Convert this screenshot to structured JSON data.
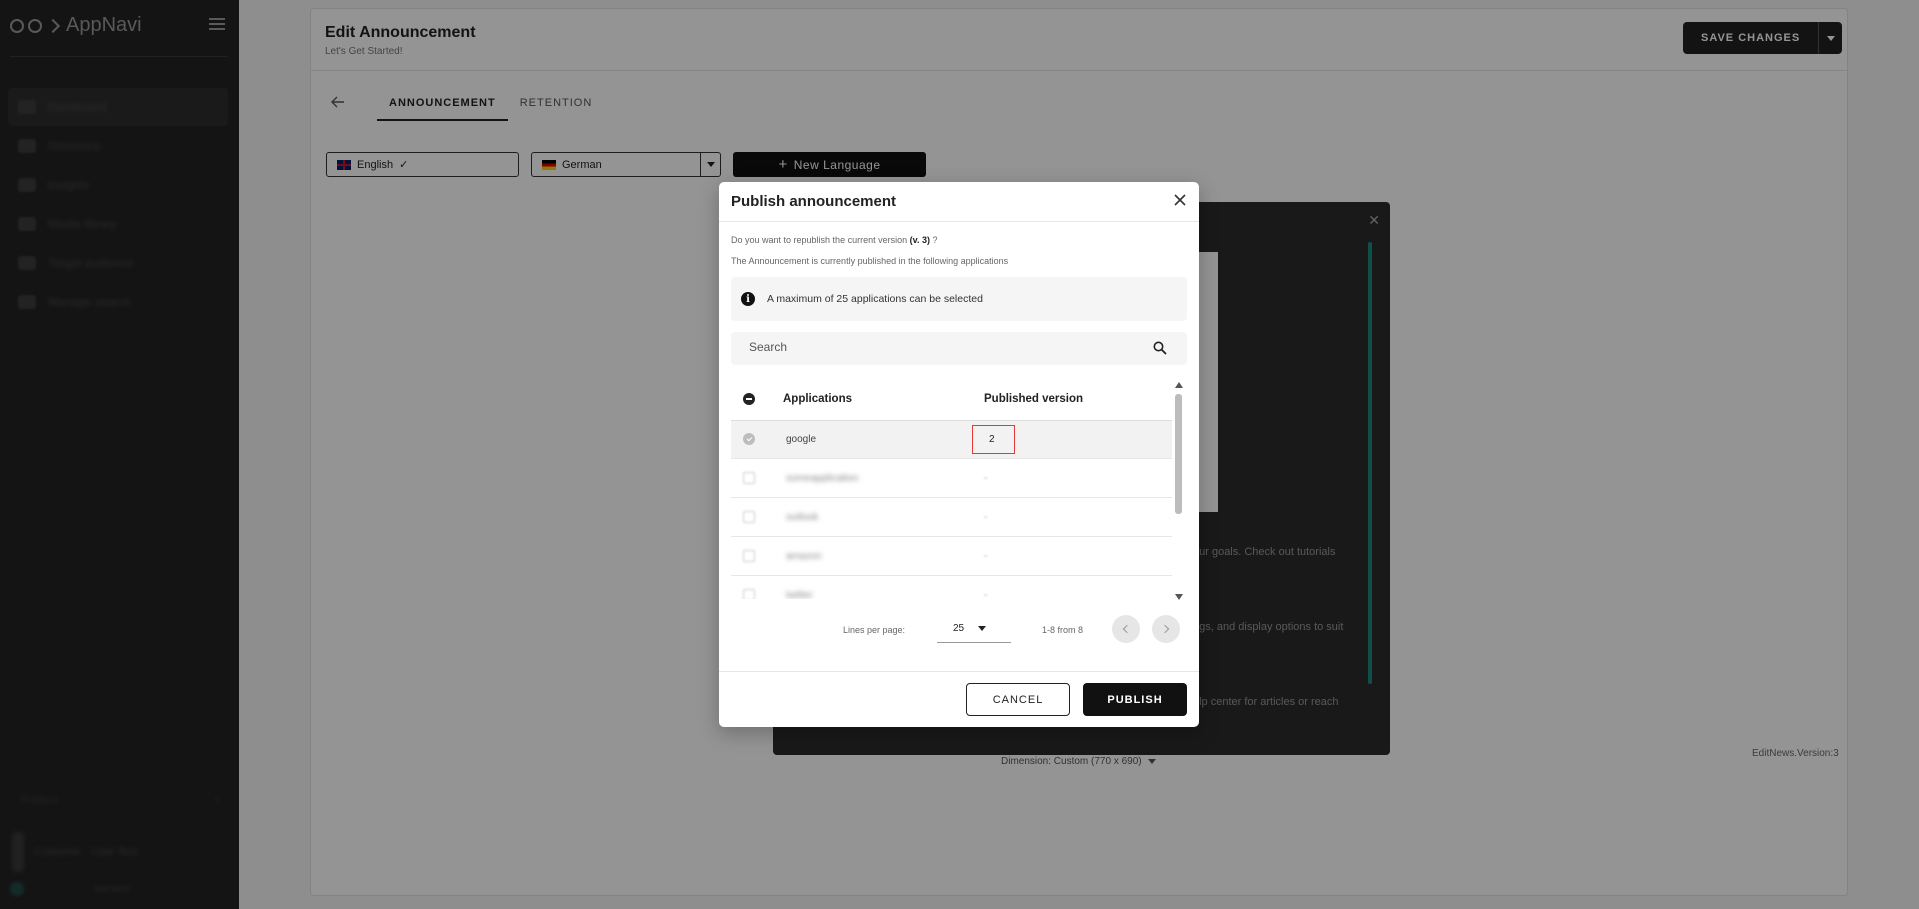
{
  "app": {
    "name": "AppNavi"
  },
  "sidebar": {
    "items": [
      {
        "label": "Dashboard",
        "icon": "dashboard-icon"
      },
      {
        "label": "Discovery",
        "icon": "discovery-icon"
      },
      {
        "label": "Insights",
        "icon": "insights-icon"
      },
      {
        "label": "Media library",
        "icon": "media-icon"
      },
      {
        "label": "Target audience",
        "icon": "audience-icon"
      },
      {
        "label": "Manage search",
        "icon": "search-manage-icon"
      }
    ],
    "bottom_label": "Product",
    "user_label": "Customer · User Test",
    "footer_label": "Version"
  },
  "header": {
    "title": "Edit Announcement",
    "subtitle": "Let's Get Started!",
    "save_label": "SAVE CHANGES"
  },
  "tabs": [
    {
      "label": "ANNOUNCEMENT",
      "active": true
    },
    {
      "label": "RETENTION",
      "active": false
    }
  ],
  "languages": {
    "english": "English",
    "german": "German",
    "new_language": "New Language"
  },
  "preview": {
    "text_1": "our goals. Check out tutorials",
    "text_2": "ngs, and display options to suit",
    "text_3": "elp center for articles or reach",
    "dimension": "Dimension: Custom (770 x 690)",
    "version_tag": "EditNews.Version:3"
  },
  "modal": {
    "title": "Publish announcement",
    "question_prefix": "Do you want to republish the current version",
    "version": "(v. 3)",
    "question_suffix": "?",
    "published_info": "The Announcement is currently published in the following applications",
    "max_info": "A maximum of 25 applications can be selected",
    "search_placeholder": "Search",
    "columns": {
      "applications": "Applications",
      "published_version": "Published version"
    },
    "rows": [
      {
        "app": "google",
        "version": "2",
        "selected": true
      },
      {
        "app": "someapplication",
        "version": "-",
        "selected": false
      },
      {
        "app": "outlook",
        "version": "-",
        "selected": false
      },
      {
        "app": "amazon",
        "version": "-",
        "selected": false
      },
      {
        "app": "twitter",
        "version": "-",
        "selected": false
      }
    ],
    "pager": {
      "label": "Lines per page:",
      "per_page": "25",
      "count": "1-8 from 8"
    },
    "cancel_label": "CANCEL",
    "publish_label": "PUBLISH"
  },
  "colors": {
    "sidebar_bg": "#232323",
    "accent_teal": "#1d8a80",
    "highlight_red": "#e53935",
    "primary_dark": "#111111"
  }
}
